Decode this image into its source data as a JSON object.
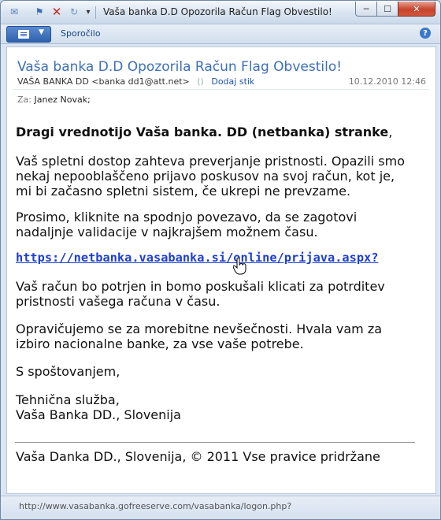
{
  "window": {
    "title": "Vaša banka D.D Opozorila Račun Flag Obvestilo!",
    "controls": {
      "minimize": "─",
      "maximize": "☐",
      "close": "✕"
    }
  },
  "quick_access": [
    {
      "icon": "mail-icon",
      "glyph": "✉"
    },
    {
      "icon": "flag-icon",
      "glyph": "⚑"
    },
    {
      "icon": "delete-icon",
      "glyph": "✕"
    },
    {
      "icon": "move-icon",
      "glyph": "↻"
    },
    {
      "icon": "customize-dropdown-icon",
      "glyph": "▾"
    }
  ],
  "ribbon": {
    "tab": "Sporočilo",
    "help": "?"
  },
  "header": {
    "subject": "Vaša banka D.D Opozorila Račun Flag Obvestilo!",
    "sender": "VAŠA BANKA DD <banka dd1@att.net>",
    "presence": "()",
    "add_contact": "Dodaj stik",
    "date": "10.12.2010 12:46",
    "to_label": "Za:",
    "to_value": "Janez Novak;"
  },
  "body": {
    "greeting_bold": "Dragi vrednotijo Vaša banka. DD (netbanka) stranke",
    "greeting_tail": ",",
    "para1": "Vaš spletni dostop zahteva preverjanje pristnosti. Opazili smo nekaj nepooblaščeno prijavo poskusov na svoj račun, kot je, mi bi začasno spletni sistem, če ukrepi ne prevzame.",
    "para2": "Prosimo, kliknite na spodnjo povezavo, da se zagotovi nadaljnje validacije v najkrajšem možnem času.",
    "link": "https://netbanka.vasabanka.si/online/prijava.aspx?",
    "para3": "Vaš račun bo potrjen in bomo poskušali klicati za potrditev pristnosti vašega računa v času.",
    "para4": "Opravičujemo se za morebitne nevšečnosti. Hvala vam za izbiro nacionalne banke, za vse vaše potrebe.",
    "regards": "S spoštovanjem,",
    "sig_line1": "Tehnična služba,",
    "sig_line2": "Vaša Banka DD., Slovenija",
    "footer": "Vaša Danka DD., Slovenija, © 2011 Vse pravice pridržane"
  },
  "status_bar": {
    "url": "http://www.vasabanka.gofreeserve.com/vasabanka/logon.php?"
  }
}
